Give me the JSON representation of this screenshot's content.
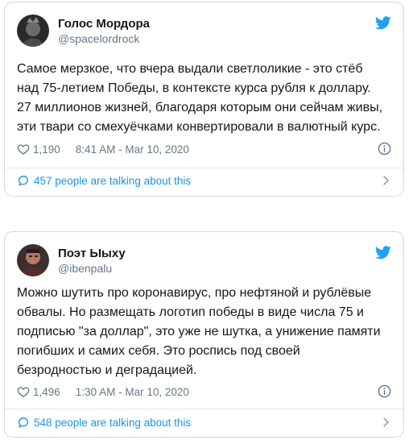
{
  "colors": {
    "accent": "#1b95e0",
    "text": "#14171a",
    "muted": "#657786",
    "border": "#cfd9de"
  },
  "tweets": [
    {
      "display_name": "Голос Мордора",
      "handle": "@spacelordrock",
      "text": "Самое мерзкое, что вчера выдали светлоликие - это стёб\nнад 75-летием Победы, в контексте курса рубля к доллару.\n27 миллионов жизней, благодаря которым они сейчам живы,\nэти твари со смехуёчками конвертировали в валютный курс.",
      "likes": "1,190",
      "timestamp": "8:41 AM - Mar 10, 2020",
      "talking": "457 people are talking about this",
      "icons": {
        "brand": "twitter-bird-icon",
        "like": "heart-icon",
        "info": "info-icon",
        "talk": "speech-bubble-icon",
        "more": "chevron-right-icon"
      }
    },
    {
      "display_name": "Поэт Ыыху",
      "handle": "@ibenpalu",
      "text": "Можно шутить про коронавирус, про нефтяной и рублёвые\nобвалы. Но размещать логотип победы в виде числа 75 и\nподписью \"за доллар\", это уже не шутка, а унижение памяти\nпогибших и самих себя. Это роспись под своей\nбезродностью и деградацией.",
      "likes": "1,496",
      "timestamp": "1:30 AM - Mar 10, 2020",
      "talking": "548 people are talking about this",
      "icons": {
        "brand": "twitter-bird-icon",
        "like": "heart-icon",
        "info": "info-icon",
        "talk": "speech-bubble-icon",
        "more": "chevron-right-icon"
      }
    }
  ]
}
